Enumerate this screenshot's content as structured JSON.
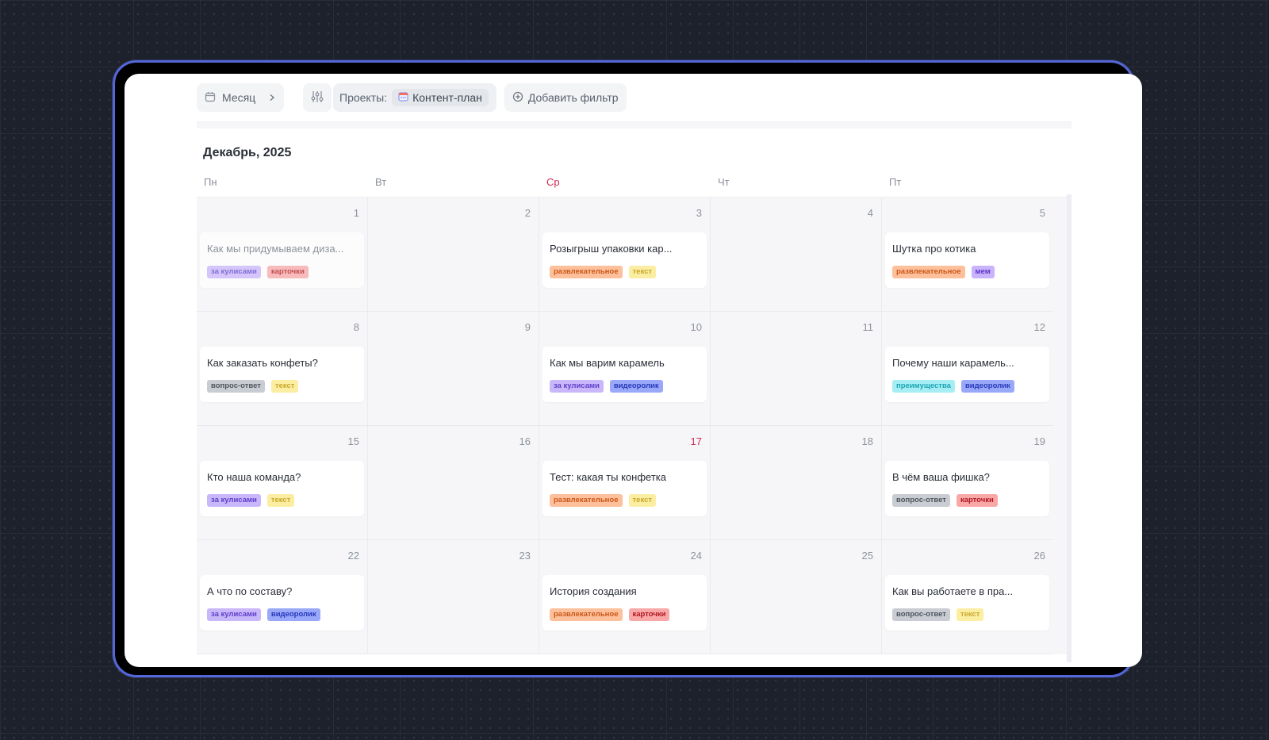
{
  "toolbar": {
    "view_label": "Месяц",
    "projects_label": "Проекты:",
    "project_name": "Контент-план",
    "add_filter_label": "Добавить фильтр"
  },
  "calendar": {
    "month_title": "Декабрь, 2025",
    "weekdays": [
      "Пн",
      "Вт",
      "Ср",
      "Чт",
      "Пт"
    ],
    "today_weekday_index": 2,
    "today_day": 17,
    "weeks": [
      [
        {
          "day": "1",
          "event": {
            "title": "Как мы придумываем диза...",
            "tags": [
              {
                "label": "за кулисами",
                "kind": "kulisy"
              },
              {
                "label": "карточки",
                "kind": "kartochki"
              }
            ]
          }
        },
        {
          "day": "2"
        },
        {
          "day": "3",
          "event": {
            "title": "Розыгрыш упаковки кар...",
            "tags": [
              {
                "label": "развлекательное",
                "kind": "razv"
              },
              {
                "label": "текст",
                "kind": "tekst"
              }
            ]
          }
        },
        {
          "day": "4"
        },
        {
          "day": "5",
          "event": {
            "title": "Шутка про котика",
            "tags": [
              {
                "label": "развлекательное",
                "kind": "razv"
              },
              {
                "label": "мем",
                "kind": "mem"
              }
            ]
          }
        }
      ],
      [
        {
          "day": "8",
          "event": {
            "title": "Как заказать конфеты?",
            "tags": [
              {
                "label": "вопрос-ответ",
                "kind": "vopros"
              },
              {
                "label": "текст",
                "kind": "tekst"
              }
            ]
          }
        },
        {
          "day": "9"
        },
        {
          "day": "10",
          "event": {
            "title": "Как мы варим карамель",
            "tags": [
              {
                "label": "за кулисами",
                "kind": "kulisy"
              },
              {
                "label": "видеоролик",
                "kind": "video"
              }
            ]
          }
        },
        {
          "day": "11"
        },
        {
          "day": "12",
          "event": {
            "title": "Почему наши карамель...",
            "tags": [
              {
                "label": "преимущества",
                "kind": "preim"
              },
              {
                "label": "видеоролик",
                "kind": "video"
              }
            ]
          }
        }
      ],
      [
        {
          "day": "15",
          "event": {
            "title": "Кто наша команда?",
            "tags": [
              {
                "label": "за кулисами",
                "kind": "kulisy"
              },
              {
                "label": "текст",
                "kind": "tekst"
              }
            ]
          }
        },
        {
          "day": "16"
        },
        {
          "day": "17",
          "event": {
            "title": "Тест: какая ты конфетка",
            "tags": [
              {
                "label": "развлекательное",
                "kind": "razv"
              },
              {
                "label": "текст",
                "kind": "tekst"
              }
            ]
          }
        },
        {
          "day": "18"
        },
        {
          "day": "19",
          "event": {
            "title": "В чём ваша фишка?",
            "tags": [
              {
                "label": "вопрос-ответ",
                "kind": "vopros"
              },
              {
                "label": "карточки",
                "kind": "kartochki"
              }
            ]
          }
        }
      ],
      [
        {
          "day": "22",
          "event": {
            "title": "А что по составу?",
            "tags": [
              {
                "label": "за кулисами",
                "kind": "kulisy"
              },
              {
                "label": "видеоролик",
                "kind": "video"
              }
            ]
          }
        },
        {
          "day": "23"
        },
        {
          "day": "24",
          "event": {
            "title": "История создания",
            "tags": [
              {
                "label": "развлекательное",
                "kind": "razv"
              },
              {
                "label": "карточки",
                "kind": "kartochki"
              }
            ]
          }
        },
        {
          "day": "25"
        },
        {
          "day": "26",
          "event": {
            "title": "Как вы работаете в пра...",
            "tags": [
              {
                "label": "вопрос-ответ",
                "kind": "vopros"
              },
              {
                "label": "текст",
                "kind": "tekst"
              }
            ]
          }
        }
      ]
    ]
  }
}
